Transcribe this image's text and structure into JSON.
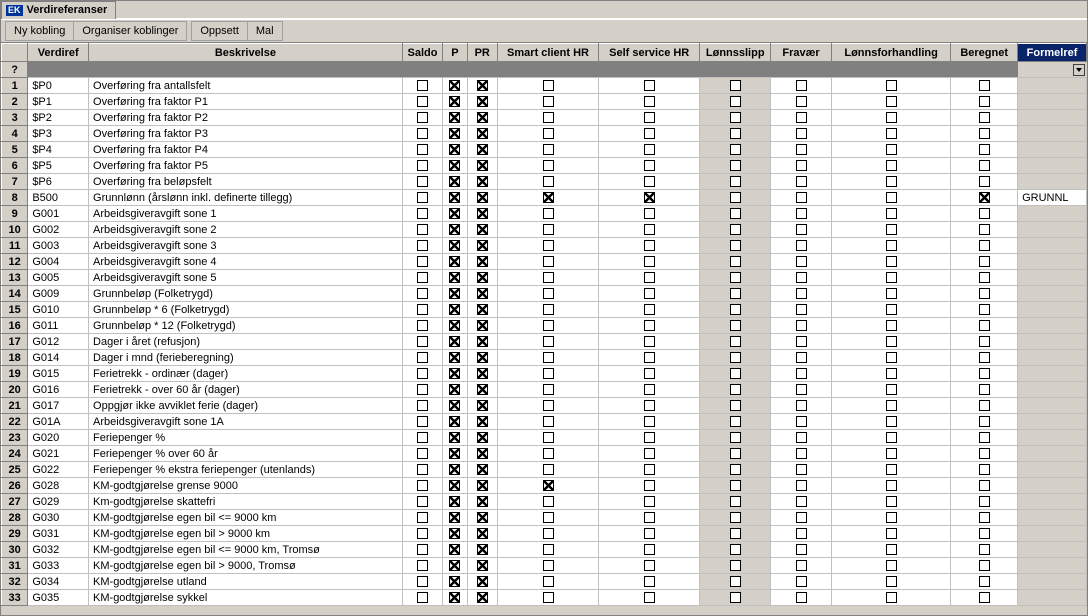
{
  "title": "Verdireferanser",
  "toolbar": {
    "ny_kobling": "Ny kobling",
    "organiser": "Organiser koblinger",
    "oppsett": "Oppsett",
    "mal": "Mal"
  },
  "headers": {
    "q": "?",
    "verdiref": "Verdiref",
    "beskrivelse": "Beskrivelse",
    "saldo": "Saldo",
    "p": "P",
    "pr": "PR",
    "smart": "Smart client HR",
    "self": "Self service HR",
    "lonnsslip": "Lønnsslipp",
    "fravaer": "Fravær",
    "lonnsforh": "Lønnsforhandling",
    "beregnet": "Beregnet",
    "formelref": "Formelref"
  },
  "rows": [
    {
      "n": 1,
      "v": "$P0",
      "b": "Overføring fra antallsfelt",
      "saldo": false,
      "p": true,
      "pr": true,
      "smart": false,
      "self": false,
      "lonn": false,
      "fra": false,
      "lfh": false,
      "ber": false,
      "f": ""
    },
    {
      "n": 2,
      "v": "$P1",
      "b": "Overføring fra faktor P1",
      "saldo": false,
      "p": true,
      "pr": true,
      "smart": false,
      "self": false,
      "lonn": false,
      "fra": false,
      "lfh": false,
      "ber": false,
      "f": ""
    },
    {
      "n": 3,
      "v": "$P2",
      "b": "Overføring fra faktor P2",
      "saldo": false,
      "p": true,
      "pr": true,
      "smart": false,
      "self": false,
      "lonn": false,
      "fra": false,
      "lfh": false,
      "ber": false,
      "f": ""
    },
    {
      "n": 4,
      "v": "$P3",
      "b": "Overføring fra faktor P3",
      "saldo": false,
      "p": true,
      "pr": true,
      "smart": false,
      "self": false,
      "lonn": false,
      "fra": false,
      "lfh": false,
      "ber": false,
      "f": ""
    },
    {
      "n": 5,
      "v": "$P4",
      "b": "Overføring fra faktor P4",
      "saldo": false,
      "p": true,
      "pr": true,
      "smart": false,
      "self": false,
      "lonn": false,
      "fra": false,
      "lfh": false,
      "ber": false,
      "f": ""
    },
    {
      "n": 6,
      "v": "$P5",
      "b": "Overføring fra faktor P5",
      "saldo": false,
      "p": true,
      "pr": true,
      "smart": false,
      "self": false,
      "lonn": false,
      "fra": false,
      "lfh": false,
      "ber": false,
      "f": ""
    },
    {
      "n": 7,
      "v": "$P6",
      "b": "Overføring fra beløpsfelt",
      "saldo": false,
      "p": true,
      "pr": true,
      "smart": false,
      "self": false,
      "lonn": false,
      "fra": false,
      "lfh": false,
      "ber": false,
      "f": ""
    },
    {
      "n": 8,
      "v": "B500",
      "b": "Grunnlønn (årslønn inkl. definerte tillegg)",
      "saldo": false,
      "p": true,
      "pr": true,
      "smart": true,
      "self": true,
      "lonn": false,
      "fra": false,
      "lfh": false,
      "ber": true,
      "f": "GRUNNL"
    },
    {
      "n": 9,
      "v": "G001",
      "b": "Arbeidsgiveravgift sone 1",
      "saldo": false,
      "p": true,
      "pr": true,
      "smart": false,
      "self": false,
      "lonn": false,
      "fra": false,
      "lfh": false,
      "ber": false,
      "f": ""
    },
    {
      "n": 10,
      "v": "G002",
      "b": "Arbeidsgiveravgift sone 2",
      "saldo": false,
      "p": true,
      "pr": true,
      "smart": false,
      "self": false,
      "lonn": false,
      "fra": false,
      "lfh": false,
      "ber": false,
      "f": ""
    },
    {
      "n": 11,
      "v": "G003",
      "b": "Arbeidsgiveravgift sone 3",
      "saldo": false,
      "p": true,
      "pr": true,
      "smart": false,
      "self": false,
      "lonn": false,
      "fra": false,
      "lfh": false,
      "ber": false,
      "f": ""
    },
    {
      "n": 12,
      "v": "G004",
      "b": "Arbeidsgiveravgift sone 4",
      "saldo": false,
      "p": true,
      "pr": true,
      "smart": false,
      "self": false,
      "lonn": false,
      "fra": false,
      "lfh": false,
      "ber": false,
      "f": ""
    },
    {
      "n": 13,
      "v": "G005",
      "b": "Arbeidsgiveravgift sone 5",
      "saldo": false,
      "p": true,
      "pr": true,
      "smart": false,
      "self": false,
      "lonn": false,
      "fra": false,
      "lfh": false,
      "ber": false,
      "f": ""
    },
    {
      "n": 14,
      "v": "G009",
      "b": "Grunnbeløp (Folketrygd)",
      "saldo": false,
      "p": true,
      "pr": true,
      "smart": false,
      "self": false,
      "lonn": false,
      "fra": false,
      "lfh": false,
      "ber": false,
      "f": ""
    },
    {
      "n": 15,
      "v": "G010",
      "b": "Grunnbeløp * 6 (Folketrygd)",
      "saldo": false,
      "p": true,
      "pr": true,
      "smart": false,
      "self": false,
      "lonn": false,
      "fra": false,
      "lfh": false,
      "ber": false,
      "f": ""
    },
    {
      "n": 16,
      "v": "G011",
      "b": "Grunnbeløp * 12 (Folketrygd)",
      "saldo": false,
      "p": true,
      "pr": true,
      "smart": false,
      "self": false,
      "lonn": false,
      "fra": false,
      "lfh": false,
      "ber": false,
      "f": ""
    },
    {
      "n": 17,
      "v": "G012",
      "b": "Dager i året (refusjon)",
      "saldo": false,
      "p": true,
      "pr": true,
      "smart": false,
      "self": false,
      "lonn": false,
      "fra": false,
      "lfh": false,
      "ber": false,
      "f": ""
    },
    {
      "n": 18,
      "v": "G014",
      "b": "Dager i mnd (ferieberegning)",
      "saldo": false,
      "p": true,
      "pr": true,
      "smart": false,
      "self": false,
      "lonn": false,
      "fra": false,
      "lfh": false,
      "ber": false,
      "f": ""
    },
    {
      "n": 19,
      "v": "G015",
      "b": "Ferietrekk - ordinær (dager)",
      "saldo": false,
      "p": true,
      "pr": true,
      "smart": false,
      "self": false,
      "lonn": false,
      "fra": false,
      "lfh": false,
      "ber": false,
      "f": ""
    },
    {
      "n": 20,
      "v": "G016",
      "b": "Ferietrekk - over 60 år (dager)",
      "saldo": false,
      "p": true,
      "pr": true,
      "smart": false,
      "self": false,
      "lonn": false,
      "fra": false,
      "lfh": false,
      "ber": false,
      "f": ""
    },
    {
      "n": 21,
      "v": "G017",
      "b": "Oppgjør ikke avviklet ferie (dager)",
      "saldo": false,
      "p": true,
      "pr": true,
      "smart": false,
      "self": false,
      "lonn": false,
      "fra": false,
      "lfh": false,
      "ber": false,
      "f": ""
    },
    {
      "n": 22,
      "v": "G01A",
      "b": "Arbeidsgiveravgift sone 1A",
      "saldo": false,
      "p": true,
      "pr": true,
      "smart": false,
      "self": false,
      "lonn": false,
      "fra": false,
      "lfh": false,
      "ber": false,
      "f": ""
    },
    {
      "n": 23,
      "v": "G020",
      "b": "Feriepenger %",
      "saldo": false,
      "p": true,
      "pr": true,
      "smart": false,
      "self": false,
      "lonn": false,
      "fra": false,
      "lfh": false,
      "ber": false,
      "f": ""
    },
    {
      "n": 24,
      "v": "G021",
      "b": "Feriepenger % over 60 år",
      "saldo": false,
      "p": true,
      "pr": true,
      "smart": false,
      "self": false,
      "lonn": false,
      "fra": false,
      "lfh": false,
      "ber": false,
      "f": ""
    },
    {
      "n": 25,
      "v": "G022",
      "b": "Feriepenger % ekstra feriepenger (utenlands)",
      "saldo": false,
      "p": true,
      "pr": true,
      "smart": false,
      "self": false,
      "lonn": false,
      "fra": false,
      "lfh": false,
      "ber": false,
      "f": ""
    },
    {
      "n": 26,
      "v": "G028",
      "b": "KM-godtgjørelse grense 9000",
      "saldo": false,
      "p": true,
      "pr": true,
      "smart": true,
      "self": false,
      "lonn": false,
      "fra": false,
      "lfh": false,
      "ber": false,
      "f": ""
    },
    {
      "n": 27,
      "v": "G029",
      "b": "Km-godtgjørelse skattefri",
      "saldo": false,
      "p": true,
      "pr": true,
      "smart": false,
      "self": false,
      "lonn": false,
      "fra": false,
      "lfh": false,
      "ber": false,
      "f": ""
    },
    {
      "n": 28,
      "v": "G030",
      "b": "KM-godtgjørelse egen bil <= 9000 km",
      "saldo": false,
      "p": true,
      "pr": true,
      "smart": false,
      "self": false,
      "lonn": false,
      "fra": false,
      "lfh": false,
      "ber": false,
      "f": ""
    },
    {
      "n": 29,
      "v": "G031",
      "b": "KM-godtgjørelse egen bil > 9000 km",
      "saldo": false,
      "p": true,
      "pr": true,
      "smart": false,
      "self": false,
      "lonn": false,
      "fra": false,
      "lfh": false,
      "ber": false,
      "f": ""
    },
    {
      "n": 30,
      "v": "G032",
      "b": "KM-godtgjørelse egen bil <= 9000 km, Tromsø",
      "saldo": false,
      "p": true,
      "pr": true,
      "smart": false,
      "self": false,
      "lonn": false,
      "fra": false,
      "lfh": false,
      "ber": false,
      "f": ""
    },
    {
      "n": 31,
      "v": "G033",
      "b": "KM-godtgjørelse egen bil > 9000, Tromsø",
      "saldo": false,
      "p": true,
      "pr": true,
      "smart": false,
      "self": false,
      "lonn": false,
      "fra": false,
      "lfh": false,
      "ber": false,
      "f": ""
    },
    {
      "n": 32,
      "v": "G034",
      "b": "KM-godtgjørelse utland",
      "saldo": false,
      "p": true,
      "pr": true,
      "smart": false,
      "self": false,
      "lonn": false,
      "fra": false,
      "lfh": false,
      "ber": false,
      "f": ""
    },
    {
      "n": 33,
      "v": "G035",
      "b": "KM-godtgjørelse sykkel",
      "saldo": false,
      "p": true,
      "pr": true,
      "smart": false,
      "self": false,
      "lonn": false,
      "fra": false,
      "lfh": false,
      "ber": false,
      "f": ""
    }
  ]
}
